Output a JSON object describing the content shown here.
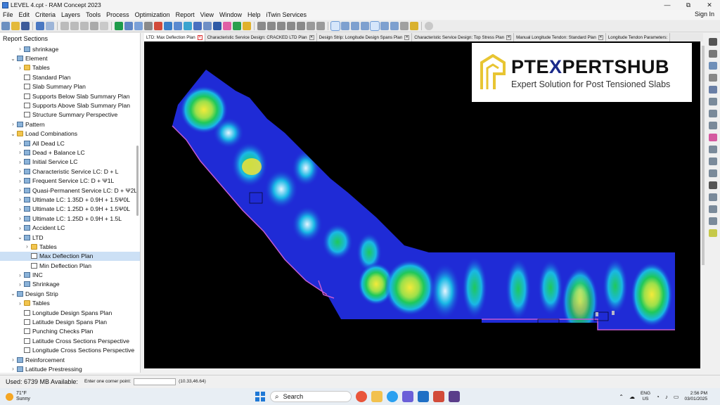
{
  "window": {
    "title": "LEVEL 4.cpt - RAM Concept 2023",
    "minimize": "—",
    "maximize": "⧉",
    "close": "✕"
  },
  "menu": {
    "items": [
      "File",
      "Edit",
      "Criteria",
      "Layers",
      "Tools",
      "Process",
      "Optimization",
      "Report",
      "View",
      "Window",
      "Help",
      "iTwin Services"
    ],
    "signin": "Sign In"
  },
  "sidebar": {
    "header": "Report Sections",
    "items": [
      {
        "label": "shrinkage",
        "level": 2,
        "chev": "›",
        "icon": "group"
      },
      {
        "label": "Element",
        "level": 1,
        "chev": "⌄",
        "icon": "group"
      },
      {
        "label": "Tables",
        "level": 2,
        "chev": "›",
        "icon": "folder"
      },
      {
        "label": "Standard Plan",
        "level": 2,
        "chev": "",
        "icon": "doc"
      },
      {
        "label": "Slab Summary Plan",
        "level": 2,
        "chev": "",
        "icon": "doc"
      },
      {
        "label": "Supports Below Slab Summary Plan",
        "level": 2,
        "chev": "",
        "icon": "doc"
      },
      {
        "label": "Supports Above Slab Summary Plan",
        "level": 2,
        "chev": "",
        "icon": "doc"
      },
      {
        "label": "Structure Summary Perspective",
        "level": 2,
        "chev": "",
        "icon": "doc"
      },
      {
        "label": "Pattern",
        "level": 1,
        "chev": "›",
        "icon": "group"
      },
      {
        "label": "Load Combinations",
        "level": 1,
        "chev": "⌄",
        "icon": "folder"
      },
      {
        "label": "All Dead LC",
        "level": 2,
        "chev": "›",
        "icon": "group"
      },
      {
        "label": "Dead + Balance LC",
        "level": 2,
        "chev": "›",
        "icon": "group"
      },
      {
        "label": "Initial Service LC",
        "level": 2,
        "chev": "›",
        "icon": "group"
      },
      {
        "label": "Characteristic Service LC: D + L",
        "level": 2,
        "chev": "›",
        "icon": "group"
      },
      {
        "label": "Frequent Service LC: D + Ψ1L",
        "level": 2,
        "chev": "›",
        "icon": "group"
      },
      {
        "label": "Quasi-Permanent Service LC: D + Ψ2L",
        "level": 2,
        "chev": "›",
        "icon": "group"
      },
      {
        "label": "Ultimate LC: 1.35D + 0.9H + 1.5Ψ0L",
        "level": 2,
        "chev": "›",
        "icon": "group"
      },
      {
        "label": "Ultimate LC: 1.25D + 0.9H + 1.5Ψ0L",
        "level": 2,
        "chev": "›",
        "icon": "group"
      },
      {
        "label": "Ultimate LC: 1.25D + 0.9H + 1.5L",
        "level": 2,
        "chev": "›",
        "icon": "group"
      },
      {
        "label": "Accident LC",
        "level": 2,
        "chev": "›",
        "icon": "group"
      },
      {
        "label": "LTD",
        "level": 2,
        "chev": "⌄",
        "icon": "group"
      },
      {
        "label": "Tables",
        "level": 3,
        "chev": "›",
        "icon": "folder"
      },
      {
        "label": "Max Deflection Plan",
        "level": 3,
        "chev": "",
        "icon": "doc",
        "selected": true
      },
      {
        "label": "Min Deflection Plan",
        "level": 3,
        "chev": "",
        "icon": "doc"
      },
      {
        "label": "INC",
        "level": 2,
        "chev": "›",
        "icon": "group"
      },
      {
        "label": "Shrinkage",
        "level": 2,
        "chev": "›",
        "icon": "group"
      },
      {
        "label": "Design Strip",
        "level": 1,
        "chev": "⌄",
        "icon": "group"
      },
      {
        "label": "Tables",
        "level": 2,
        "chev": "›",
        "icon": "folder"
      },
      {
        "label": "Longitude Design Spans Plan",
        "level": 2,
        "chev": "",
        "icon": "doc"
      },
      {
        "label": "Latitude Design Spans Plan",
        "level": 2,
        "chev": "",
        "icon": "doc"
      },
      {
        "label": "Punching Checks Plan",
        "level": 2,
        "chev": "",
        "icon": "doc"
      },
      {
        "label": "Latitude Cross Sections Perspective",
        "level": 2,
        "chev": "",
        "icon": "doc"
      },
      {
        "label": "Longitude Cross Sections Perspective",
        "level": 2,
        "chev": "",
        "icon": "doc"
      },
      {
        "label": "Reinforcement",
        "level": 1,
        "chev": "›",
        "icon": "group"
      },
      {
        "label": "Latitude Prestressing",
        "level": 1,
        "chev": "›",
        "icon": "group"
      }
    ]
  },
  "tabs": [
    {
      "label": "LTD: Max Deflection Plan",
      "active": true
    },
    {
      "label": "Characteristic Service Design: CRACKED LTD Plan",
      "active": false
    },
    {
      "label": "Design Strip: Longitude Design Spans Plan",
      "active": false
    },
    {
      "label": "Characteristic Service Design: Top Stress Plan",
      "active": false
    },
    {
      "label": "Manual Longitude Tendon: Standard Plan",
      "active": false
    },
    {
      "label": "Longitude Tendon Parameters:",
      "active": false
    }
  ],
  "logo": {
    "title_pre": "PTE",
    "title_x": "X",
    "title_post": "PERTSHUB",
    "tagline": "Expert Solution for Post Tensioned Slabs",
    "brand_color": "#e8c532",
    "x_color": "#1a2a8a"
  },
  "status": {
    "memory": "Used: 6739 MB   Available:",
    "prompt": "Enter one corner point:",
    "coords": "(10.33,46.64)"
  },
  "taskbar": {
    "temp": "71°F",
    "weather": "Sunny",
    "search": "Search",
    "lang1": "ENG",
    "lang2": "US",
    "time": "2:56 PM",
    "date": "03/01/2025"
  },
  "colors": {
    "canvas_bg": "#000000",
    "contour_low": "#1f2bd6",
    "contour_mid": "#19b8e6",
    "contour_green": "#1fc85a",
    "contour_high": "#ece03a",
    "selection": "#cce0f5"
  }
}
